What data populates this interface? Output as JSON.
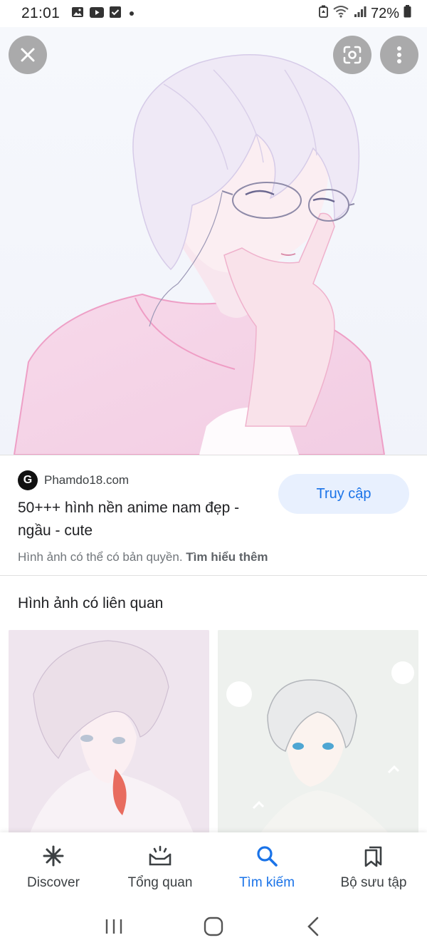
{
  "status_bar": {
    "time": "21:01",
    "battery": "72%",
    "icons": [
      "gallery-icon",
      "youtube-icon",
      "checkbox-icon",
      "dot-icon",
      "battery-saver-icon",
      "wifi-icon",
      "signal-icon",
      "battery-icon"
    ]
  },
  "viewer": {
    "close_icon": "close-icon",
    "lens_icon": "google-lens-icon",
    "more_icon": "more-vert-icon"
  },
  "result": {
    "source_badge": "G",
    "source_name": "Phamdo18.com",
    "title": "50+++ hình nền anime nam đẹp - ngầu - cute",
    "visit_label": "Truy cập",
    "copyright_text": "Hình ảnh có thể có bản quyền.",
    "learn_more_label": "Tìm hiểu thêm"
  },
  "related": {
    "title": "Hình ảnh có liên quan"
  },
  "bottom_nav": {
    "items": [
      {
        "label": "Discover",
        "icon": "asterisk-icon",
        "active": false
      },
      {
        "label": "Tổng quan",
        "icon": "updates-icon",
        "active": false
      },
      {
        "label": "Tìm kiếm",
        "icon": "search-icon",
        "active": true
      },
      {
        "label": "Bộ sưu tập",
        "icon": "collections-icon",
        "active": false
      }
    ]
  },
  "system_nav": {
    "icons": [
      "recent-apps-icon",
      "home-icon",
      "back-icon"
    ]
  },
  "colors": {
    "accent": "#1a73e8",
    "visit_button_bg": "#e8f0fe"
  }
}
